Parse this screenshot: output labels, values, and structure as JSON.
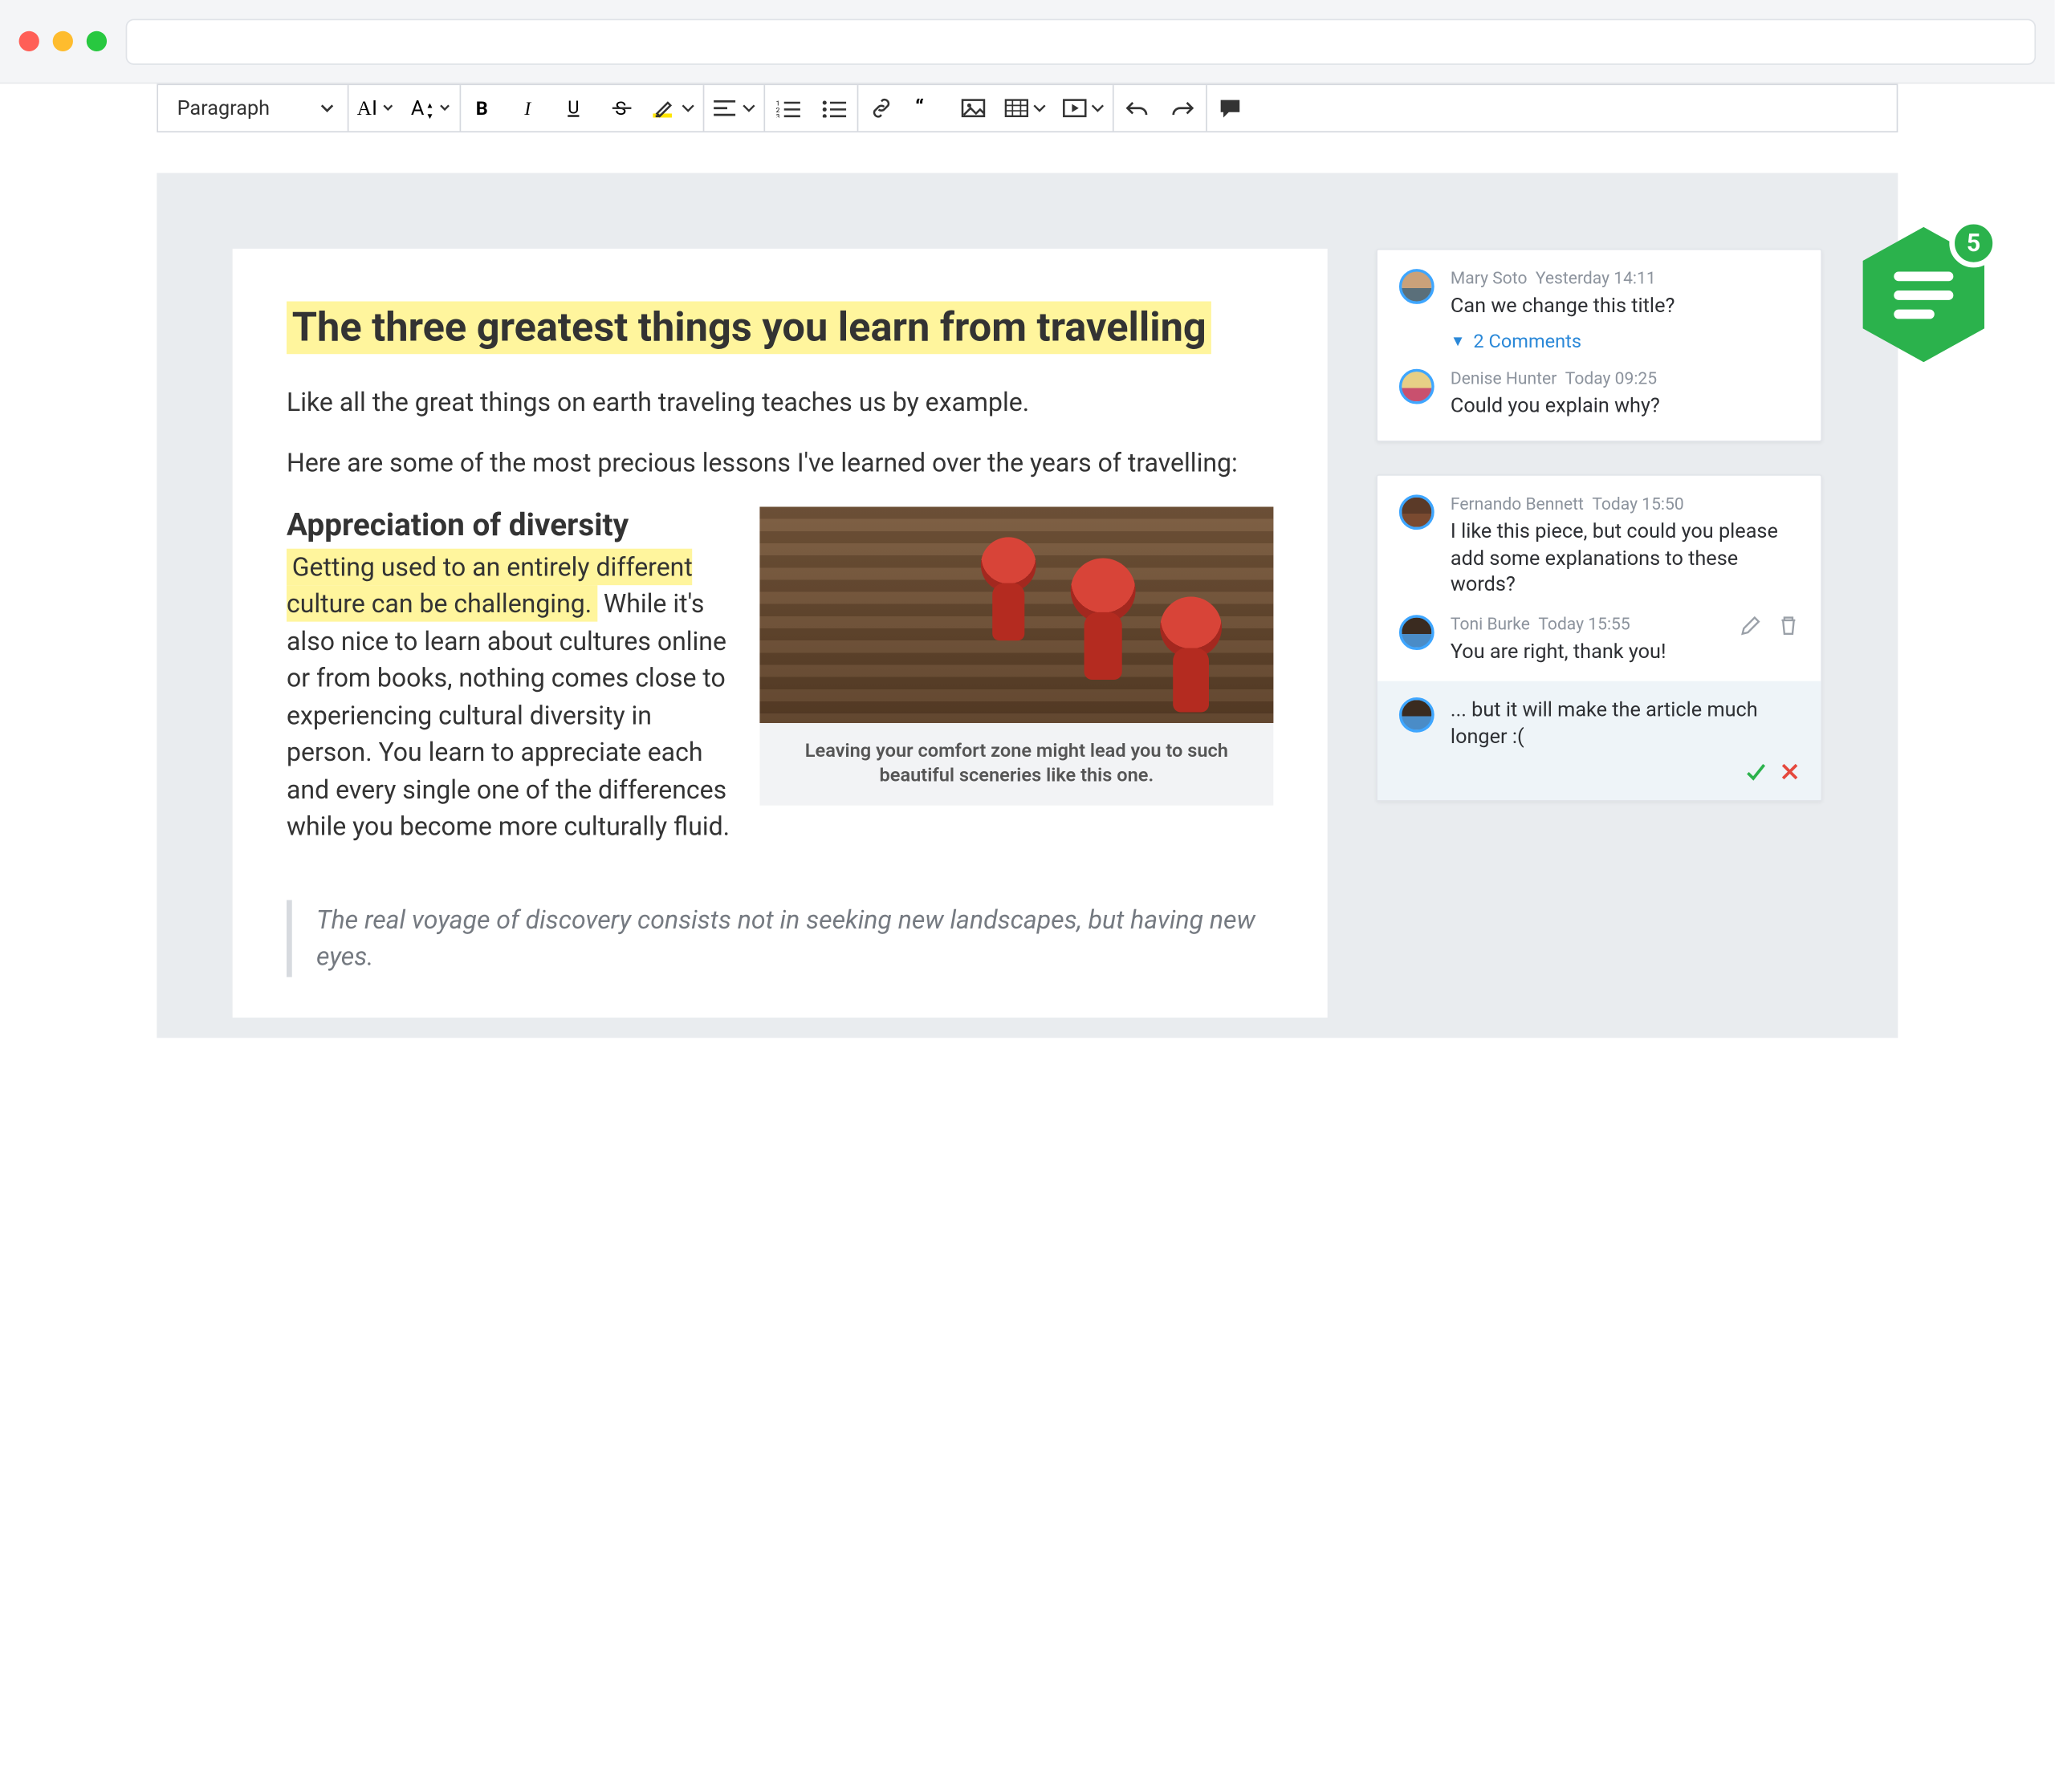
{
  "badge": {
    "count": "5"
  },
  "toolbar": {
    "block_style": "Paragraph"
  },
  "document": {
    "title": "The three greatest things you learn from travelling",
    "p1": "Like all the great things on earth traveling teaches us by example.",
    "p2": "Here are some of the most precious lessons I've learned over the years of travelling:",
    "h2": "Appreciation of diversity",
    "body_hl": "Getting used to an entirely different culture can be challenging.",
    "body_rest": " While it's also nice to learn about cultures online or from books, nothing comes close to experiencing cultural diversity in person. You learn to appreciate each and every single one of the differences while you become more culturally fluid.",
    "caption": "Leaving your comfort zone might lead you to such beautiful sceneries like this one.",
    "quote": "The real voyage of discovery consists not in seeking new landscapes, but having new eyes."
  },
  "threads": [
    {
      "comments": [
        {
          "author": "Mary Soto",
          "time": "Yesterday 14:11",
          "text": "Can we change this title?"
        },
        {
          "author": "Denise Hunter",
          "time": "Today 09:25",
          "text": "Could you explain why?"
        }
      ],
      "toggle": "2 Comments"
    },
    {
      "comments": [
        {
          "author": "Fernando Bennett",
          "time": "Today 15:50",
          "text": "I like this piece, but could you please add some explanations to these words?"
        },
        {
          "author": "Toni Burke",
          "time": "Today 15:55",
          "text": "You are right, thank you!"
        }
      ],
      "compose": "... but it will make the article much longer :("
    }
  ]
}
